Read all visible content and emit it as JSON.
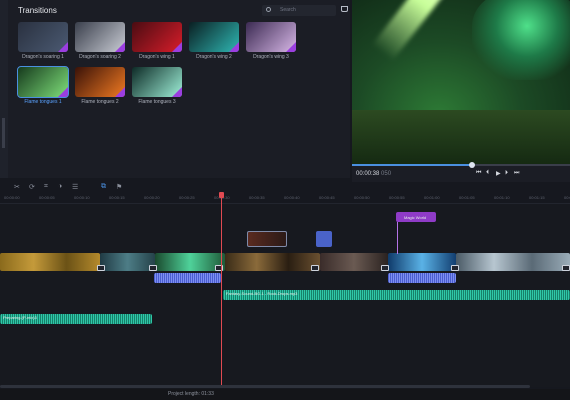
{
  "panel": {
    "title": "Transitions",
    "search_placeholder": "Search",
    "tiles": [
      {
        "label": "Dragon's soaring 1",
        "bg": "linear-gradient(135deg,#2a3140,#4b5a72)",
        "selected": false
      },
      {
        "label": "Dragon's soaring 2",
        "bg": "linear-gradient(135deg,#3a3f4c,#c9ccd4)",
        "selected": false
      },
      {
        "label": "Dragon's wing 1",
        "bg": "linear-gradient(135deg,#4a0c12,#d81d2a)",
        "selected": false
      },
      {
        "label": "Dragon's wing 2",
        "bg": "linear-gradient(135deg,#0a1f22,#2fb7b3)",
        "selected": false
      },
      {
        "label": "Dragon's wing 3",
        "bg": "linear-gradient(135deg,#3b2a52,#d7b7e6)",
        "selected": false
      },
      {
        "label": "Flame tongues 1",
        "bg": "linear-gradient(135deg,#163a1d,#7fe07a)",
        "selected": true
      },
      {
        "label": "Flame tongues 2",
        "bg": "linear-gradient(135deg,#3a1208,#f07a22)",
        "selected": false
      },
      {
        "label": "Flame tongues 3",
        "bg": "linear-gradient(135deg,#0d2a26,#9ff0d8)",
        "selected": false
      }
    ]
  },
  "preview": {
    "timecode": "00:00:38",
    "frames": "050",
    "progress": 0.55
  },
  "toolbar": {
    "icons": [
      "cut-icon",
      "rotate-icon",
      "crop-icon",
      "color-icon",
      "list-icon",
      "overlay-icon",
      "flag-icon"
    ]
  },
  "ruler": {
    "ticks": [
      "00:00:00",
      "00:00:05",
      "00:00:10",
      "00:00:15",
      "00:00:20",
      "00:00:25",
      "00:00:30",
      "00:00:35",
      "00:00:40",
      "00:00:45",
      "00:00:50",
      "00:00:55",
      "00:01:00",
      "00:01:05",
      "00:01:10",
      "00:01:15",
      "00:01:20"
    ]
  },
  "timeline": {
    "title_clip": "Magic World",
    "audio_clips": [
      {
        "label": "Fantasy-Sound-BG-1 - Rock-Drops.mp3"
      },
      {
        "label": "Preparing-(P-mix)3"
      }
    ]
  },
  "status": {
    "project_length": "Project length:  01:33"
  }
}
